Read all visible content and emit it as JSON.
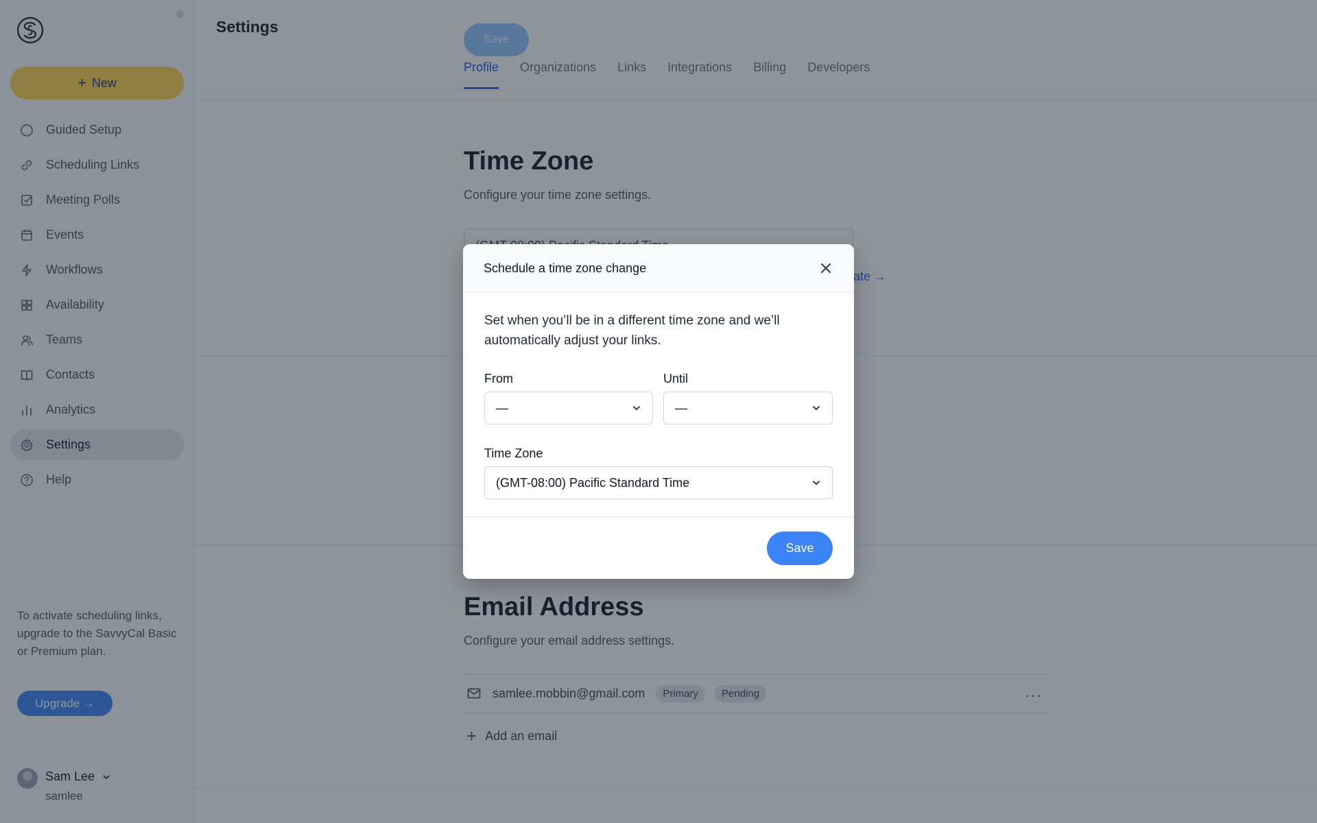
{
  "sidebar": {
    "new_label": "New",
    "items": [
      {
        "label": "Guided Setup",
        "icon": "circle-icon"
      },
      {
        "label": "Scheduling Links",
        "icon": "link-icon"
      },
      {
        "label": "Meeting Polls",
        "icon": "checkbox-icon"
      },
      {
        "label": "Events",
        "icon": "calendar-icon"
      },
      {
        "label": "Workflows",
        "icon": "lightning-icon"
      },
      {
        "label": "Availability",
        "icon": "grid-icon"
      },
      {
        "label": "Teams",
        "icon": "users-icon"
      },
      {
        "label": "Contacts",
        "icon": "book-icon"
      },
      {
        "label": "Analytics",
        "icon": "bar-chart-icon"
      },
      {
        "label": "Settings",
        "icon": "gear-icon",
        "active": true
      },
      {
        "label": "Help",
        "icon": "help-icon"
      }
    ],
    "upgrade_text": "To activate scheduling links, upgrade to the SavvyCal Basic or Premium plan.",
    "upgrade_label": "Upgrade →",
    "user_name": "Sam Lee",
    "user_handle": "samlee"
  },
  "header": {
    "title": "Settings",
    "save_label": "Save",
    "tabs": [
      {
        "label": "Profile",
        "active": true
      },
      {
        "label": "Organizations"
      },
      {
        "label": "Links"
      },
      {
        "label": "Integrations"
      },
      {
        "label": "Billing"
      },
      {
        "label": "Developers"
      }
    ]
  },
  "time_zone": {
    "title": "Time Zone",
    "subtitle": "Configure your time zone settings.",
    "current_value": "(GMT-08:00) Pacific Standard Time",
    "link_text": "date →"
  },
  "email": {
    "title": "Email Address",
    "subtitle": "Configure your email address settings.",
    "address": "samlee.mobbin@gmail.com",
    "badges": [
      "Primary",
      "Pending"
    ],
    "add_label": "Add an email"
  },
  "modal": {
    "title": "Schedule a time zone change",
    "description": "Set when you’ll be in a different time zone and we’ll automatically adjust your links.",
    "from_label": "From",
    "from_value": "—",
    "until_label": "Until",
    "until_value": "—",
    "tz_label": "Time Zone",
    "tz_value": "(GMT-08:00) Pacific Standard Time",
    "save_label": "Save"
  },
  "colors": {
    "accent": "#3b82f6",
    "new_button": "#fcd34d",
    "overlay": "rgba(31,41,55,0.5)"
  }
}
